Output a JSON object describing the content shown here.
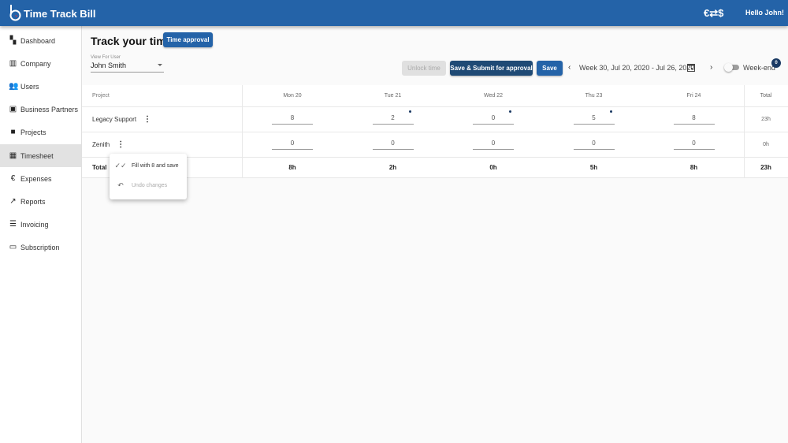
{
  "header": {
    "app_title": "Time Track Bill",
    "currency_icon": "€⇄$",
    "greeting": "Hello John!",
    "color": "#2463a8"
  },
  "sidebar": {
    "items": [
      {
        "label": "Dashboard",
        "icon": "dashboard-icon",
        "glyph": "▚"
      },
      {
        "label": "Company",
        "icon": "building-icon",
        "glyph": "▥"
      },
      {
        "label": "Users",
        "icon": "users-icon",
        "glyph": "👥"
      },
      {
        "label": "Business Partners",
        "icon": "contact-card-icon",
        "glyph": "▣"
      },
      {
        "label": "Projects",
        "icon": "folder-icon",
        "glyph": "■"
      },
      {
        "label": "Timesheet",
        "icon": "calendar-icon",
        "glyph": "▦",
        "active": true
      },
      {
        "label": "Expenses",
        "icon": "euro-icon",
        "glyph": "€"
      },
      {
        "label": "Reports",
        "icon": "trending-icon",
        "glyph": "↗"
      },
      {
        "label": "Invoicing",
        "icon": "list-icon",
        "glyph": "☰"
      },
      {
        "label": "Subscription",
        "icon": "credit-card-icon",
        "glyph": "▭"
      }
    ]
  },
  "main": {
    "title": "Track your time",
    "time_approval": "Time approval",
    "view_for_user_label": "View For User",
    "view_for_user_value": "John Smith",
    "unlock_time": "Unlock time",
    "save_submit": "Save & Submit for approval",
    "save": "Save",
    "week": "Week 30, Jul 20, 2020 - Jul 26, 2020",
    "weekend_label": "Week-end",
    "weekend_on": false,
    "badge": "0"
  },
  "table": {
    "headers": [
      "Project",
      "Mon 20",
      "Tue 21",
      "Wed 22",
      "Thu 23",
      "Fri 24",
      "Total"
    ],
    "rows": [
      {
        "project": "Legacy Support",
        "values": [
          "8",
          "2",
          "0",
          "5",
          "8"
        ],
        "modified": [
          false,
          true,
          true,
          true,
          false
        ],
        "total": "23h"
      },
      {
        "project": "Zenith",
        "values": [
          "0",
          "0",
          "0",
          "0",
          "0"
        ],
        "modified": [
          false,
          false,
          false,
          false,
          false
        ],
        "total": "0h"
      }
    ],
    "totals": {
      "label": "Total",
      "values": [
        "8h",
        "2h",
        "0h",
        "5h",
        "8h"
      ],
      "total": "23h"
    }
  },
  "menu": {
    "items": [
      {
        "label": "Fill with 8 and save",
        "icon": "double-check-icon",
        "disabled": false
      },
      {
        "label": "Undo changes",
        "icon": "undo-icon",
        "disabled": true
      }
    ]
  }
}
